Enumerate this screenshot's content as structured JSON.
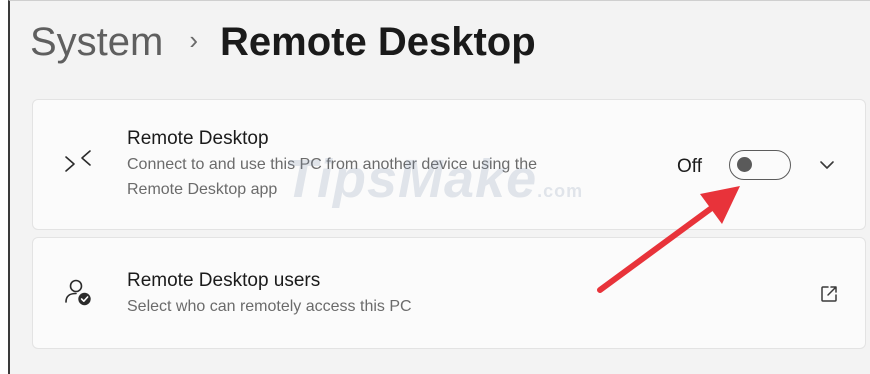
{
  "breadcrumb": {
    "parent": "System",
    "separator": "›",
    "current": "Remote Desktop"
  },
  "remote_desktop_card": {
    "icon": "remote-desktop-icon",
    "title": "Remote Desktop",
    "description": "Connect to and use this PC from another device using the Remote Desktop app",
    "toggle_state_label": "Off",
    "toggle_on": false,
    "expand_icon": "chevron-down-icon"
  },
  "users_card": {
    "icon": "person-check-icon",
    "title": "Remote Desktop users",
    "description": "Select who can remotely access this PC",
    "action_icon": "open-external-icon"
  },
  "watermark": {
    "text": "TipsMake",
    "suffix": ".com"
  },
  "annotation": {
    "arrow_color": "#e8333a"
  }
}
